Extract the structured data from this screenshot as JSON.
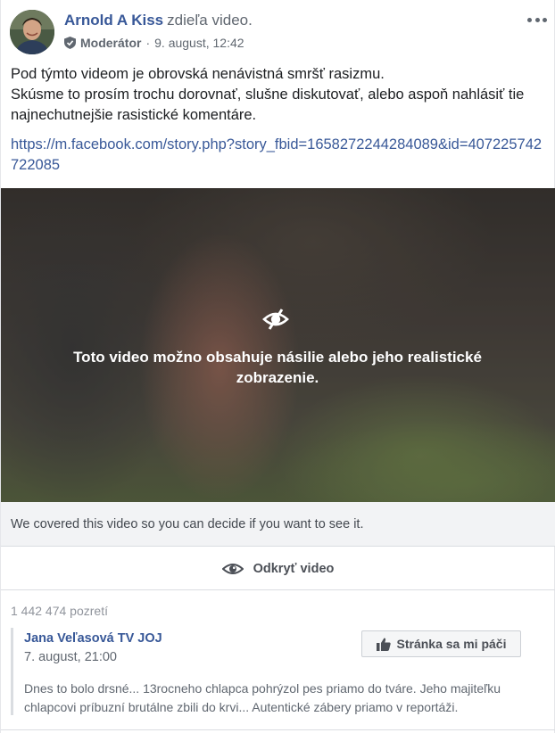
{
  "post": {
    "author": {
      "name": "Arnold A Kiss",
      "action": "zdieľa video.",
      "role": "Moderátor",
      "timestamp": "9. august, 12:42"
    },
    "more_icon": "more-horizontal-icon",
    "text_lines": [
      "Pod týmto videom je obrovská nenávistná smršť rasizmu.",
      "Skúsme to prosím trochu dorovnať, slušne diskutovať, alebo aspoň nahlásiť tie najnechutnejšie rasistické komentáre."
    ],
    "link": "https://m.facebook.com/story.php?story_fbid=1658272244284089&id=407225742722085"
  },
  "video": {
    "warning_icon": "eye-off-icon",
    "warning_text": "Toto video možno obsahuje násilie alebo jeho realistické zobrazenie.",
    "covered_notice": "We covered this video so you can decide if you want to see it.",
    "reveal_label": "Odkryť video",
    "reveal_icon": "eye-icon"
  },
  "stats": {
    "views": "1 442 474 pozretí"
  },
  "shared": {
    "page_name": "Jana Veľasová TV JOJ",
    "date": "7. august, 21:00",
    "like_page_label": "Stránka sa mi páči",
    "like_icon": "thumbs-up-icon",
    "description": "Dnes to bolo drsné... 13rocneho chlapca pohrýzol pes priamo do tváre. Jeho majiteľku chlapcovi príbuzní brutálne zbili do krvi... Autentické zábery priamo v reportáži."
  },
  "colors": {
    "link": "#385898",
    "secondary_text": "#606770",
    "background": "#ffffff"
  }
}
